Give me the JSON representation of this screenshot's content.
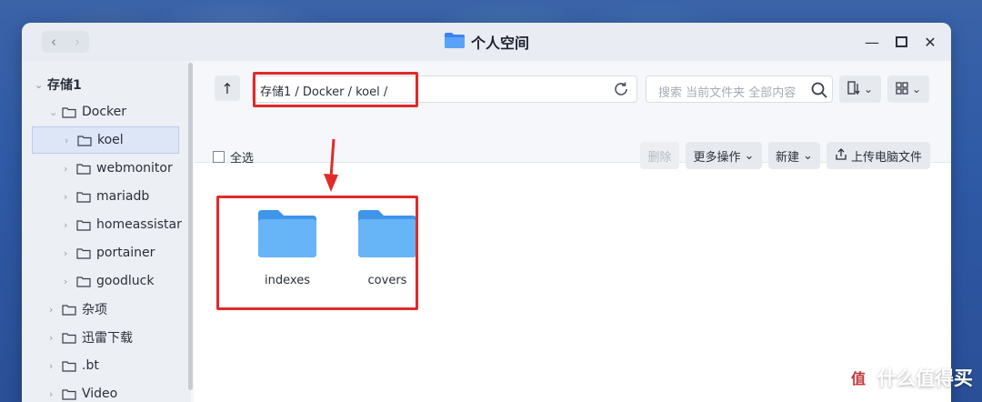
{
  "window": {
    "title": "个人空间",
    "nav_back": "‹",
    "nav_forward": "›",
    "minimize": "—",
    "maximize": "□",
    "close": "✕"
  },
  "sidebar": {
    "root": "存储1",
    "items": [
      {
        "label": "Docker",
        "level": 1,
        "expanded": true
      },
      {
        "label": "koel",
        "level": 2,
        "selected": true
      },
      {
        "label": "webmonitor",
        "level": 2
      },
      {
        "label": "mariadb",
        "level": 2
      },
      {
        "label": "homeassistar",
        "level": 2
      },
      {
        "label": "portainer",
        "level": 2
      },
      {
        "label": "goodluck",
        "level": 2
      },
      {
        "label": "杂项",
        "level": 1
      },
      {
        "label": "迅雷下载",
        "level": 1
      },
      {
        "label": ".bt",
        "level": 1
      },
      {
        "label": "Video",
        "level": 1
      }
    ]
  },
  "toolbar": {
    "up_icon": "↑",
    "path": "存储1 / Docker / koel /",
    "refresh_icon": "refresh-icon",
    "search_placeholder": "搜索 当前文件夹 全部内容",
    "select_all": "全选",
    "delete": "删除",
    "more_actions": "更多操作",
    "new": "新建",
    "upload": "上传电脑文件"
  },
  "files": [
    {
      "name": "indexes",
      "type": "folder"
    },
    {
      "name": "covers",
      "type": "folder"
    }
  ],
  "watermark": {
    "logo": "值",
    "text": "什么值得买"
  },
  "colors": {
    "folder": "#5aaef5",
    "highlight": "#e12a2a",
    "selected_bg": "#dde6f7"
  }
}
